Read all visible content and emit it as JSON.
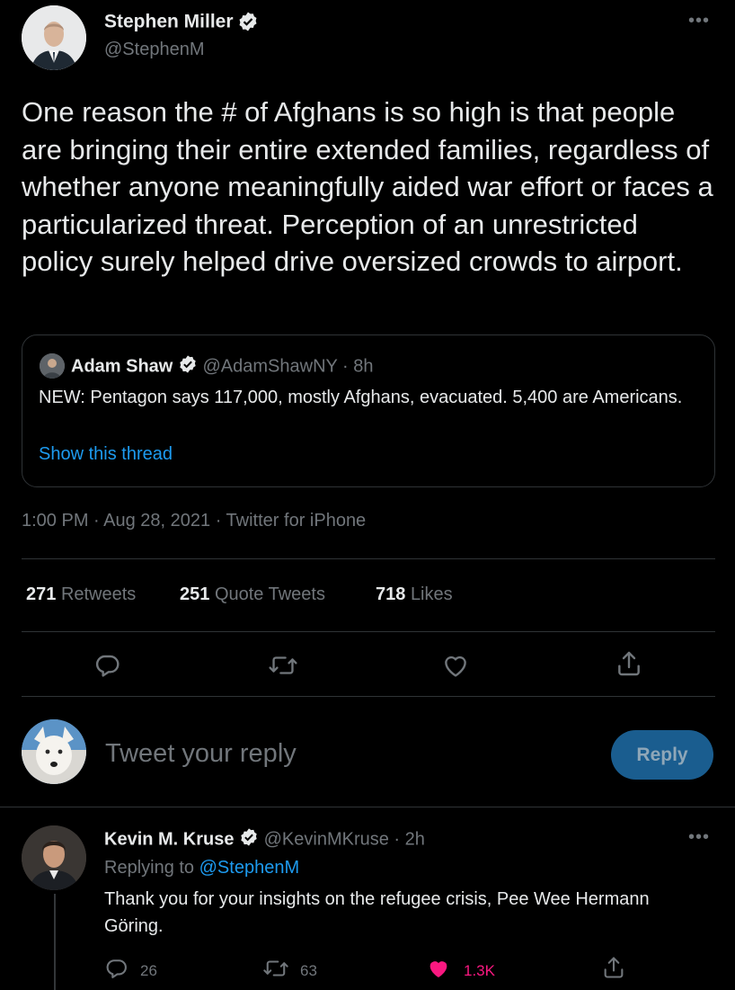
{
  "tweet": {
    "author_name": "Stephen Miller",
    "author_handle": "@StephenM",
    "text": "One reason the # of Afghans is so high is that people are bringing their entire extended families, regardless of whether anyone meaningfully aided war effort or faces a particularized threat. Perception of an unrestricted policy surely helped drive oversized crowds to airport.",
    "timestamp": "1:00 PM · Aug 28, 2021 · Twitter for iPhone",
    "more_icon": "more-horizontal-icon"
  },
  "quote": {
    "author_name": "Adam Shaw",
    "author_handle_time": "@AdamShawNY · 8h",
    "text": "NEW: Pentagon says 117,000, mostly Afghans, evacuated. 5,400 are Americans.",
    "show_thread": "Show this thread"
  },
  "stats": {
    "retweets_count": "271",
    "retweets_label": "Retweets",
    "quotes_count": "251",
    "quotes_label": "Quote Tweets",
    "likes_count": "718",
    "likes_label": "Likes"
  },
  "actions": [
    "reply-icon",
    "retweet-icon",
    "like-icon",
    "share-icon"
  ],
  "compose": {
    "placeholder": "Tweet your reply",
    "button_label": "Reply"
  },
  "reply": {
    "author_name": "Kevin M. Kruse",
    "author_handle_time": "@KevinMKruse · 2h",
    "replying_to_label": "Replying to",
    "replying_to_handle": "@StephenM",
    "text": "Thank you for your insights on the refugee crisis, Pee Wee Hermann Göring.",
    "reply_count": "26",
    "retweet_count": "63",
    "like_count": "1.3K",
    "like_color": "#f91880"
  },
  "colors": {
    "background": "#000000",
    "text": "#e7e9ea",
    "muted": "#71767b",
    "link": "#1d9bf0",
    "divider": "#2f3336"
  }
}
